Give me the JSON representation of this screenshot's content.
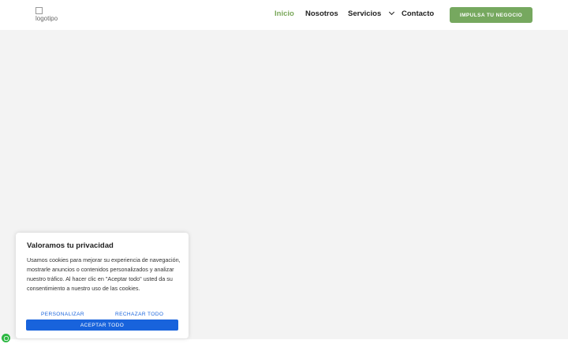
{
  "header": {
    "logo_alt": "logotipo",
    "nav": {
      "inicio": "Inicio",
      "nosotros": "Nosotros",
      "servicios": "Servicios",
      "contacto": "Contacto"
    },
    "cta_label": "IMPULSA TU NEGOCIO"
  },
  "cookie_banner": {
    "title": "Valoramos tu privacidad",
    "text": "Usamos cookies para mejorar su experiencia de navegación, mostrarle anuncios o contenidos personalizados y analizar nuestro tráfico. Al hacer clic en \"Aceptar todo\" usted da su consentimiento a nuestro uso de las cookies.",
    "customize_label": "PERSONALIZAR",
    "reject_label": "RECHAZAR TODO",
    "accept_label": "ACEPTAR TODO"
  },
  "colors": {
    "accent_green": "#76a85f",
    "active_nav": "#7aa85a",
    "consent_blue": "#1863dc",
    "whatsapp_green": "#2bb741"
  },
  "icons": {
    "logo": "broken-image-icon",
    "servicios_dropdown": "chevron-down-icon",
    "floating_chat": "whatsapp-icon"
  }
}
